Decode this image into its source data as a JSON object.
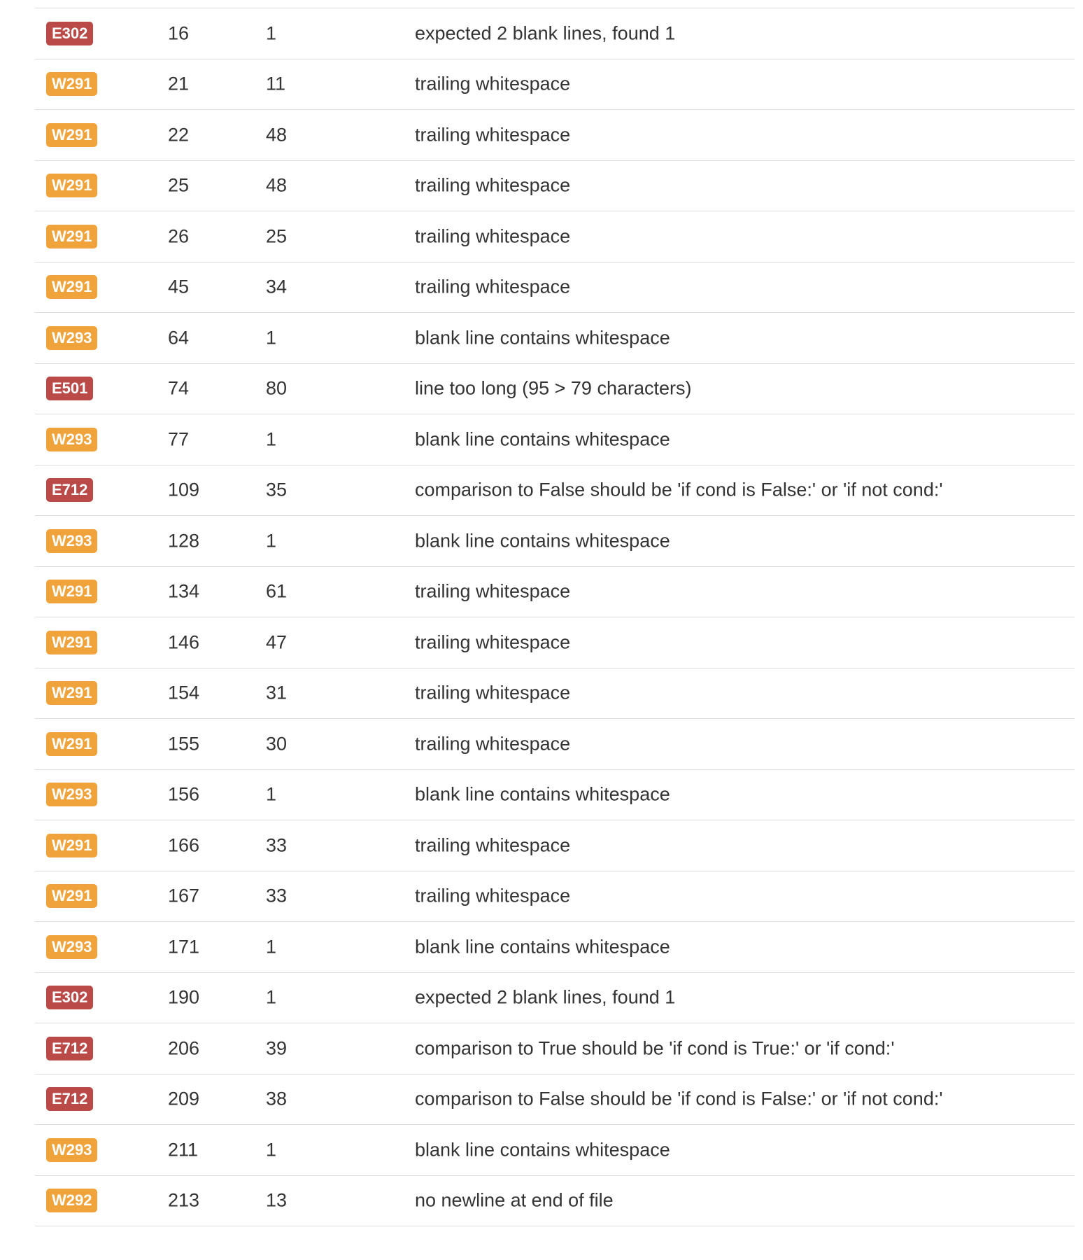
{
  "colors": {
    "error": "#b94a48",
    "warning": "#f0a33b"
  },
  "rows": [
    {
      "code": "E302",
      "severity": "error",
      "line": "16",
      "col": "1",
      "message": "expected 2 blank lines, found 1"
    },
    {
      "code": "W291",
      "severity": "warning",
      "line": "21",
      "col": "11",
      "message": "trailing whitespace"
    },
    {
      "code": "W291",
      "severity": "warning",
      "line": "22",
      "col": "48",
      "message": "trailing whitespace"
    },
    {
      "code": "W291",
      "severity": "warning",
      "line": "25",
      "col": "48",
      "message": "trailing whitespace"
    },
    {
      "code": "W291",
      "severity": "warning",
      "line": "26",
      "col": "25",
      "message": "trailing whitespace"
    },
    {
      "code": "W291",
      "severity": "warning",
      "line": "45",
      "col": "34",
      "message": "trailing whitespace"
    },
    {
      "code": "W293",
      "severity": "warning",
      "line": "64",
      "col": "1",
      "message": "blank line contains whitespace"
    },
    {
      "code": "E501",
      "severity": "error",
      "line": "74",
      "col": "80",
      "message": "line too long (95 > 79 characters)"
    },
    {
      "code": "W293",
      "severity": "warning",
      "line": "77",
      "col": "1",
      "message": "blank line contains whitespace"
    },
    {
      "code": "E712",
      "severity": "error",
      "line": "109",
      "col": "35",
      "message": "comparison to False should be 'if cond is False:' or 'if not cond:'"
    },
    {
      "code": "W293",
      "severity": "warning",
      "line": "128",
      "col": "1",
      "message": "blank line contains whitespace"
    },
    {
      "code": "W291",
      "severity": "warning",
      "line": "134",
      "col": "61",
      "message": "trailing whitespace"
    },
    {
      "code": "W291",
      "severity": "warning",
      "line": "146",
      "col": "47",
      "message": "trailing whitespace"
    },
    {
      "code": "W291",
      "severity": "warning",
      "line": "154",
      "col": "31",
      "message": "trailing whitespace"
    },
    {
      "code": "W291",
      "severity": "warning",
      "line": "155",
      "col": "30",
      "message": "trailing whitespace"
    },
    {
      "code": "W293",
      "severity": "warning",
      "line": "156",
      "col": "1",
      "message": "blank line contains whitespace"
    },
    {
      "code": "W291",
      "severity": "warning",
      "line": "166",
      "col": "33",
      "message": "trailing whitespace"
    },
    {
      "code": "W291",
      "severity": "warning",
      "line": "167",
      "col": "33",
      "message": "trailing whitespace"
    },
    {
      "code": "W293",
      "severity": "warning",
      "line": "171",
      "col": "1",
      "message": "blank line contains whitespace"
    },
    {
      "code": "E302",
      "severity": "error",
      "line": "190",
      "col": "1",
      "message": "expected 2 blank lines, found 1"
    },
    {
      "code": "E712",
      "severity": "error",
      "line": "206",
      "col": "39",
      "message": "comparison to True should be 'if cond is True:' or 'if cond:'"
    },
    {
      "code": "E712",
      "severity": "error",
      "line": "209",
      "col": "38",
      "message": "comparison to False should be 'if cond is False:' or 'if not cond:'"
    },
    {
      "code": "W293",
      "severity": "warning",
      "line": "211",
      "col": "1",
      "message": "blank line contains whitespace"
    },
    {
      "code": "W292",
      "severity": "warning",
      "line": "213",
      "col": "13",
      "message": "no newline at end of file"
    }
  ]
}
